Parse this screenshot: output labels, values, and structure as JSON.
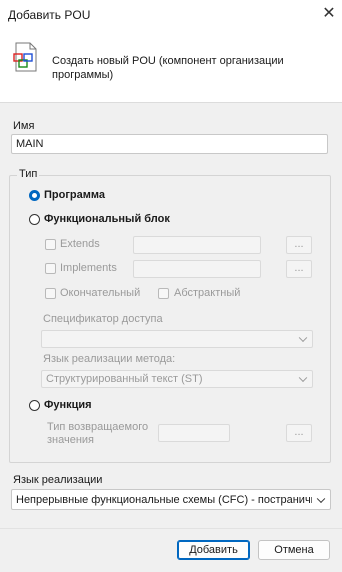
{
  "window": {
    "title": "Добавить POU",
    "close_glyph": "✕"
  },
  "header": {
    "icon": "pou-document-icon",
    "description": "Создать новый POU (компонент организации программы)"
  },
  "name": {
    "label": "Имя",
    "value": "MAIN"
  },
  "type": {
    "label": "Тип",
    "program": {
      "label": "Программа",
      "selected": true
    },
    "function_block": {
      "label": "Функциональный блок",
      "selected": false,
      "extends_label": "Extends",
      "implements_label": "Implements",
      "browse_label": "...",
      "final_label": "Окончательный",
      "abstract_label": "Абстрактный",
      "access_specifier_label": "Спецификатор доступа",
      "access_specifier_value": "",
      "method_language_label": "Язык реализации метода:",
      "method_language_value": "Структурированный текст (ST)"
    },
    "function": {
      "label": "Функция",
      "selected": false,
      "return_type_label": "Тип возвращаемого значения",
      "browse_label": "..."
    }
  },
  "implementation_language": {
    "label": "Язык реализации",
    "value": "Непрерывные функциональные схемы (CFC) - постраничн"
  },
  "buttons": {
    "add": "Добавить",
    "cancel": "Отмена"
  },
  "colors": {
    "accent": "#0067c0",
    "disabled_text": "#9a9a9a"
  }
}
